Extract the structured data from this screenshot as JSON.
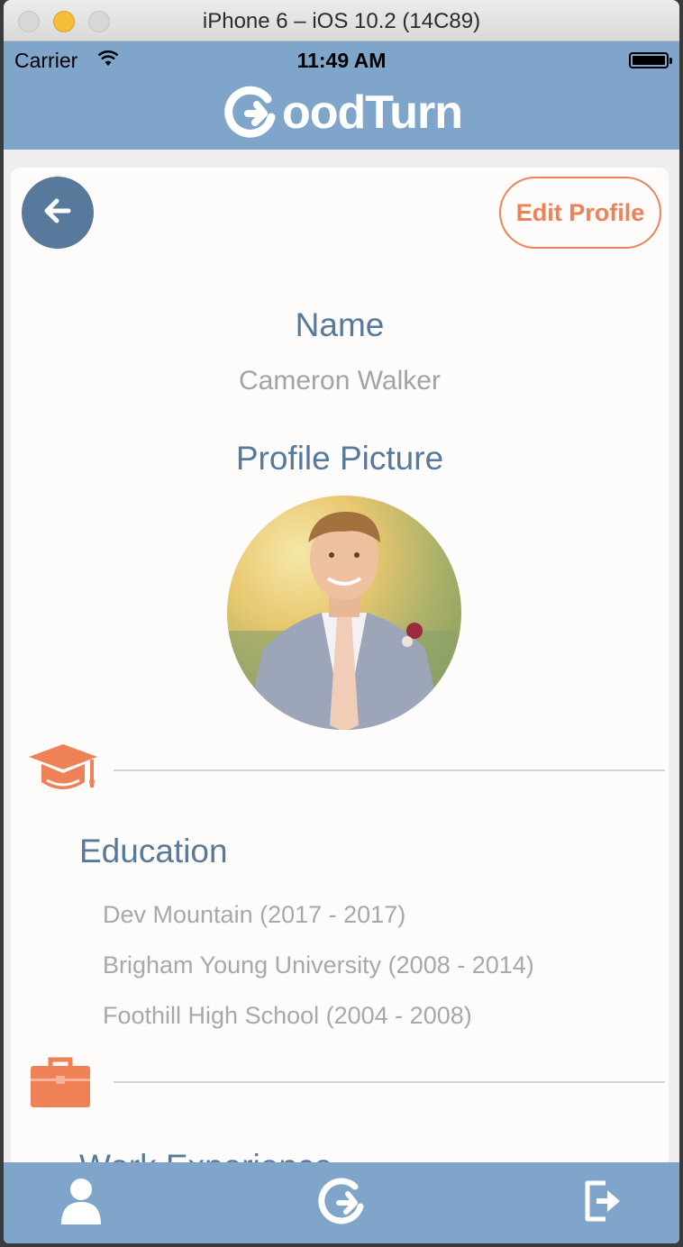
{
  "window": {
    "title": "iPhone 6 – iOS 10.2 (14C89)"
  },
  "status_bar": {
    "carrier": "Carrier",
    "time": "11:49 AM"
  },
  "header": {
    "logo_text": "oodTurn",
    "logo_icon": "refresh-g-icon"
  },
  "actions": {
    "edit_profile": "Edit Profile",
    "back_icon": "arrow-left-icon"
  },
  "profile": {
    "name_label": "Name",
    "name_value": "Cameron Walker",
    "picture_label": "Profile Picture"
  },
  "education": {
    "icon": "graduation-cap-icon",
    "title": "Education",
    "items": [
      "Dev Mountain (2017 - 2017)",
      "Brigham Young University (2008 - 2014)",
      "Foothill High School (2004 - 2008)"
    ]
  },
  "work": {
    "icon": "briefcase-icon",
    "title": "Work Experience"
  },
  "tab_bar": {
    "profile_icon": "user-icon",
    "home_icon": "refresh-icon",
    "logout_icon": "logout-icon"
  },
  "colors": {
    "brand_blue": "#7fa5cb",
    "dark_blue": "#57799b",
    "accent_orange": "#ef8156"
  }
}
